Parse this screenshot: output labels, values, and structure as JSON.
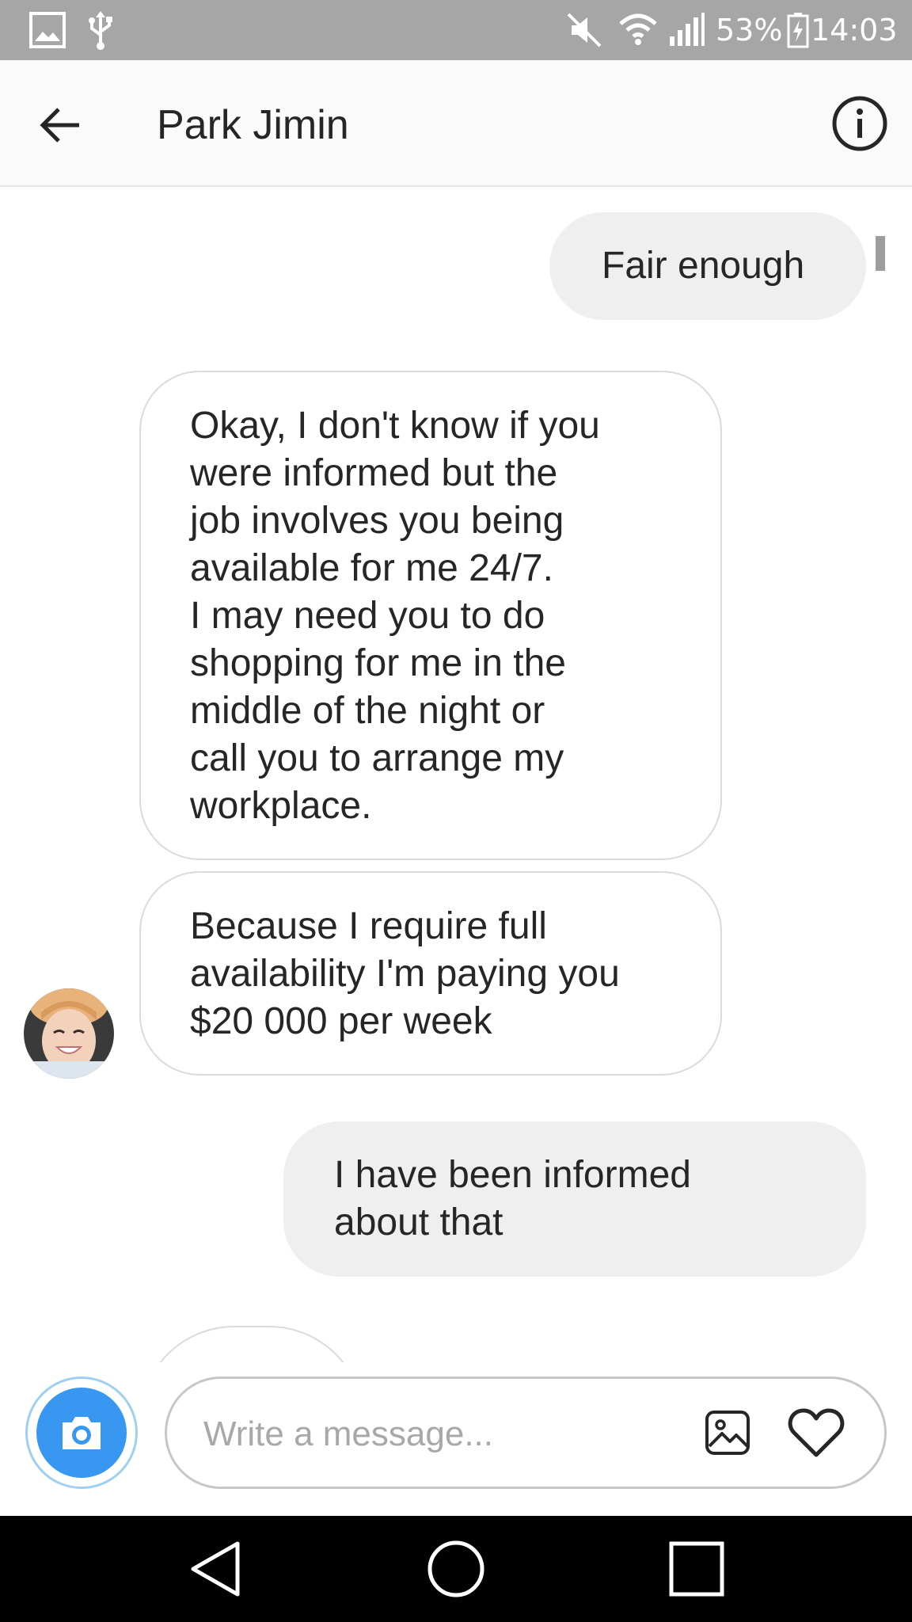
{
  "status_bar": {
    "battery_percent": "53%",
    "time": "14:03",
    "icons": [
      "image-icon",
      "usb-icon",
      "mute-icon",
      "wifi-icon",
      "signal-icon",
      "battery-charging-icon"
    ]
  },
  "header": {
    "contact_name": "Park Jimin",
    "back_icon": "arrow-left-icon",
    "info_icon": "info-icon"
  },
  "messages": [
    {
      "direction": "sent",
      "text": "Fair enough"
    },
    {
      "direction": "received",
      "text": "Okay, I don't know if you\nwere informed but the\njob involves you being\navailable for me 24/7.\nI may need you to do\nshopping for me in the\nmiddle of the night or\ncall you to arrange my\nworkplace."
    },
    {
      "direction": "received",
      "text": "Because I require full\navailability I'm paying you\n$20 000 per week"
    },
    {
      "direction": "sent",
      "text": "I have been informed\nabout that"
    }
  ],
  "composer": {
    "placeholder": "Write a message...",
    "camera_icon": "camera-icon",
    "gallery_icon": "gallery-icon",
    "heart_icon": "heart-icon"
  },
  "nav_bar": {
    "icons": [
      "back-triangle-icon",
      "home-circle-icon",
      "recents-square-icon"
    ]
  },
  "colors": {
    "status_bar": "#a6a6a6",
    "sent_bubble": "#efefef",
    "received_border": "#dbdbdb",
    "accent": "#3897f0",
    "text": "#262626",
    "nav_bar": "#000000"
  }
}
